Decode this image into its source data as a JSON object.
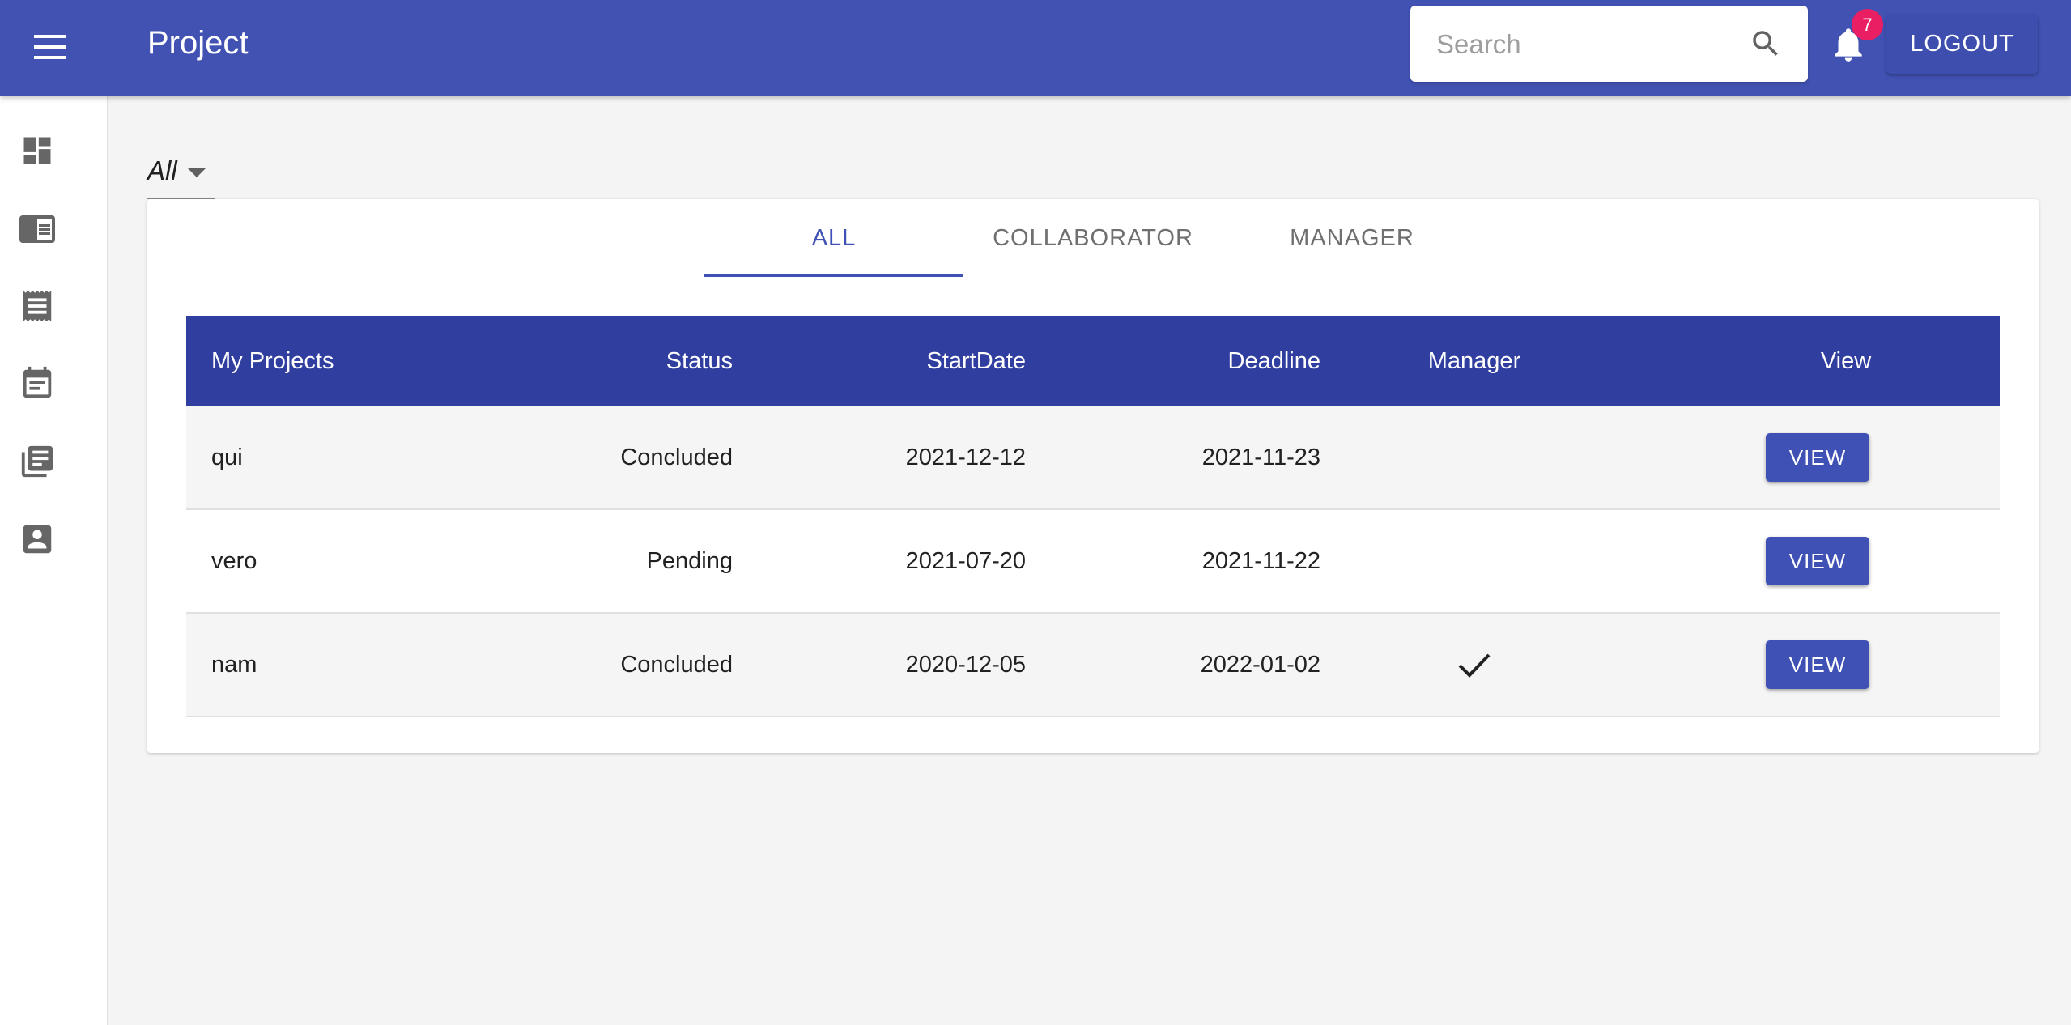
{
  "appbar": {
    "menu_icon": "menu-icon",
    "title": "Project",
    "search_placeholder": "Search",
    "search_value": "",
    "search_icon": "search-icon",
    "notifications_icon": "bell-icon",
    "notification_count": "7",
    "logout_label": "LOGOUT",
    "color": "#4152b3"
  },
  "sidebar": {
    "items": [
      {
        "icon": "dashboard-icon"
      },
      {
        "icon": "chrome-reader-icon"
      },
      {
        "icon": "receipt-icon"
      },
      {
        "icon": "event-note-icon"
      },
      {
        "icon": "library-books-icon"
      },
      {
        "icon": "contact-icon"
      }
    ]
  },
  "filter": {
    "value": "All"
  },
  "tabs": [
    {
      "label": "ALL",
      "active": true
    },
    {
      "label": "COLLABORATOR",
      "active": false
    },
    {
      "label": "MANAGER",
      "active": false
    }
  ],
  "table": {
    "headers": {
      "name": "My Projects",
      "status": "Status",
      "start": "StartDate",
      "deadline": "Deadline",
      "manager": "Manager",
      "view": "View"
    },
    "rows": [
      {
        "name": "qui",
        "status": "Concluded",
        "start": "2021-12-12",
        "deadline": "2021-11-23",
        "manager": false,
        "view_label": "VIEW"
      },
      {
        "name": "vero",
        "status": "Pending",
        "start": "2021-07-20",
        "deadline": "2021-11-22",
        "manager": false,
        "view_label": "VIEW"
      },
      {
        "name": "nam",
        "status": "Concluded",
        "start": "2020-12-05",
        "deadline": "2022-01-02",
        "manager": true,
        "view_label": "VIEW"
      }
    ],
    "header_color": "#303f9f",
    "accent_color": "#3f51b5"
  }
}
